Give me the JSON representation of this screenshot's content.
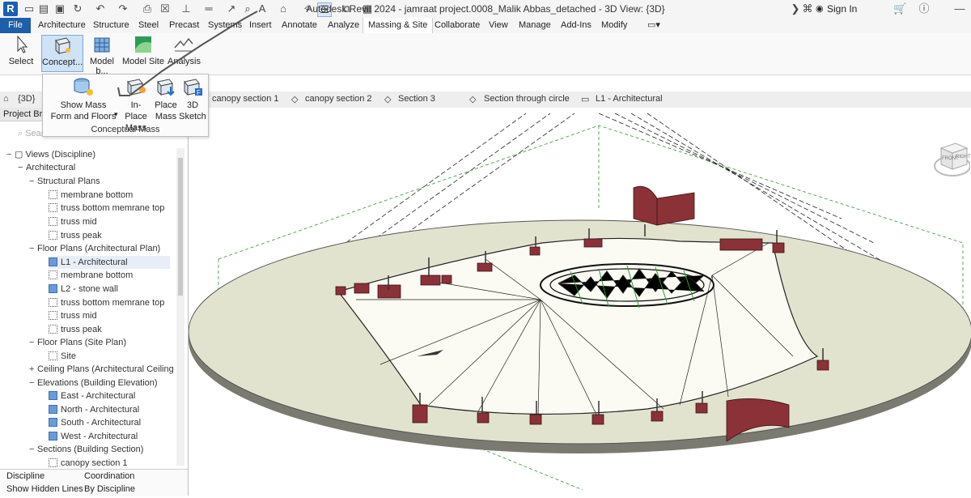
{
  "titlebar": {
    "title": "Autodesk Revit 2024 - jamraat project.0008_Malik Abbas_detached - 3D View: {3D}",
    "sign_in": "Sign In",
    "app_logo": "R"
  },
  "tabs": [
    "File",
    "Architecture",
    "Structure",
    "Steel",
    "Precast",
    "Systems",
    "Insert",
    "Annotate",
    "Analyze",
    "Massing & Site",
    "Collaborate",
    "View",
    "Manage",
    "Add-Ins",
    "Modify"
  ],
  "ribbon": {
    "select": "Select",
    "conceptual": "Concept...",
    "model_b": "Model b...",
    "model_site": "Model Site",
    "analysis": "Analysis"
  },
  "mass_dropdown": {
    "show_mass": "Show Mass",
    "form_floors": "Form and Floors",
    "in_place": "In-Place",
    "in_place2": "Mass",
    "place": "Place",
    "place2": "Mass",
    "sketch": "3D",
    "sketch2": "Sketch",
    "panel_title": "Conceptual Mass"
  },
  "view_tabs": {
    "current": "{3D}",
    "t1": "canopy section 1",
    "t2": "canopy section 2",
    "t3": "Section 3",
    "t4": "Section through circle",
    "t5": "L1 - Architectural"
  },
  "browser": {
    "title": "Project Bro",
    "search_placeholder": "Search",
    "nodes": [
      {
        "label": "Views (Discipline)"
      },
      {
        "label": "Architectural"
      },
      {
        "label": "Structural Plans"
      },
      {
        "label": "membrane bottom"
      },
      {
        "label": "truss bottom memrane top"
      },
      {
        "label": "truss mid"
      },
      {
        "label": "truss peak"
      },
      {
        "label": "Floor Plans (Architectural Plan)"
      },
      {
        "label": "L1 - Architectural"
      },
      {
        "label": "membrane bottom"
      },
      {
        "label": "L2 - stone wall"
      },
      {
        "label": "truss bottom memrane top"
      },
      {
        "label": "truss mid"
      },
      {
        "label": "truss peak"
      },
      {
        "label": "Floor Plans (Site Plan)"
      },
      {
        "label": "Site"
      },
      {
        "label": "Ceiling Plans (Architectural Ceiling Plan"
      },
      {
        "label": "Elevations (Building Elevation)"
      },
      {
        "label": "East - Architectural"
      },
      {
        "label": "North - Architectural"
      },
      {
        "label": "South - Architectural"
      },
      {
        "label": "West - Architectural"
      },
      {
        "label": "Sections (Building Section)"
      },
      {
        "label": "canopy section 1"
      }
    ]
  },
  "properties": {
    "discipline_label": "Discipline",
    "discipline_value": "Coordination",
    "hidden_label": "Show Hidden Lines",
    "hidden_value": "By Discipline"
  },
  "viewcube": {
    "front": "FRONT",
    "right": "RIGHT"
  },
  "colors": {
    "file_tab": "#1f5ea8",
    "site_fill": "#e2e3cf",
    "membrane": "#fbfbf4",
    "wall": "#8b3138",
    "accent": "#2e9a2e"
  }
}
